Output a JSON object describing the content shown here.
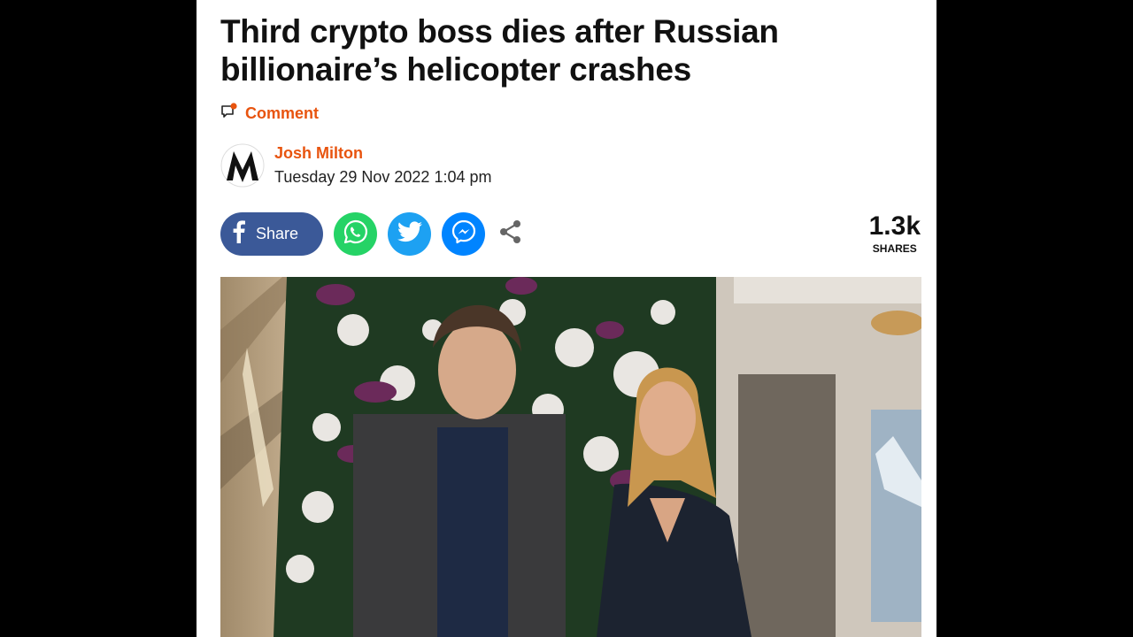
{
  "article": {
    "headline": "Third crypto boss dies after Russian billionaire’s helicopter crashes",
    "comment_label": "Comment",
    "author_name": "Josh Milton",
    "date": "Tuesday 29 Nov 2022 1:04 pm"
  },
  "share": {
    "facebook_label": "Share",
    "count": "1.3k",
    "count_label": "SHARES"
  },
  "colors": {
    "accent": "#e8540f",
    "facebook": "#3b5998",
    "whatsapp": "#25d366",
    "twitter": "#1da1f2",
    "messenger": "#0084ff"
  },
  "icons": [
    "comment-icon",
    "facebook-icon",
    "whatsapp-icon",
    "twitter-icon",
    "messenger-icon",
    "share-icon"
  ]
}
